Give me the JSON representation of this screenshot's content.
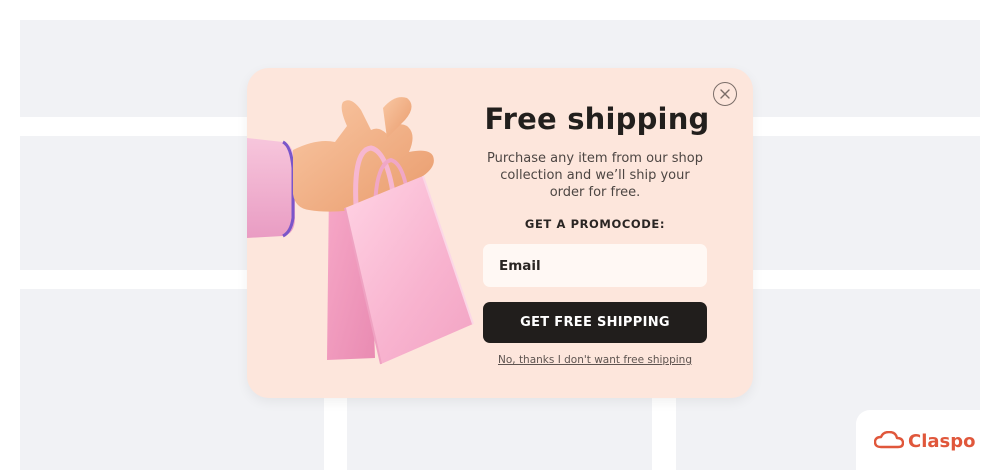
{
  "popup": {
    "title": "Free shipping",
    "description": "Purchase any item from our shop collection and we’ll ship your order for free.",
    "promo_label": "GET A PROMOCODE:",
    "email_placeholder": "Email",
    "cta_label": "GET FREE SHIPPING",
    "decline_label": "No, thanks I don't want free shipping",
    "close_icon": "close-icon",
    "illustration": "hand-holding-shopping-bag"
  },
  "brand": {
    "name": "Claspo",
    "icon": "cloud-logo-icon",
    "color": "#e0573b"
  },
  "colors": {
    "popup_background": "#fde6dc",
    "cta_background": "#211e1c",
    "page_placeholder": "#f1f2f5"
  }
}
